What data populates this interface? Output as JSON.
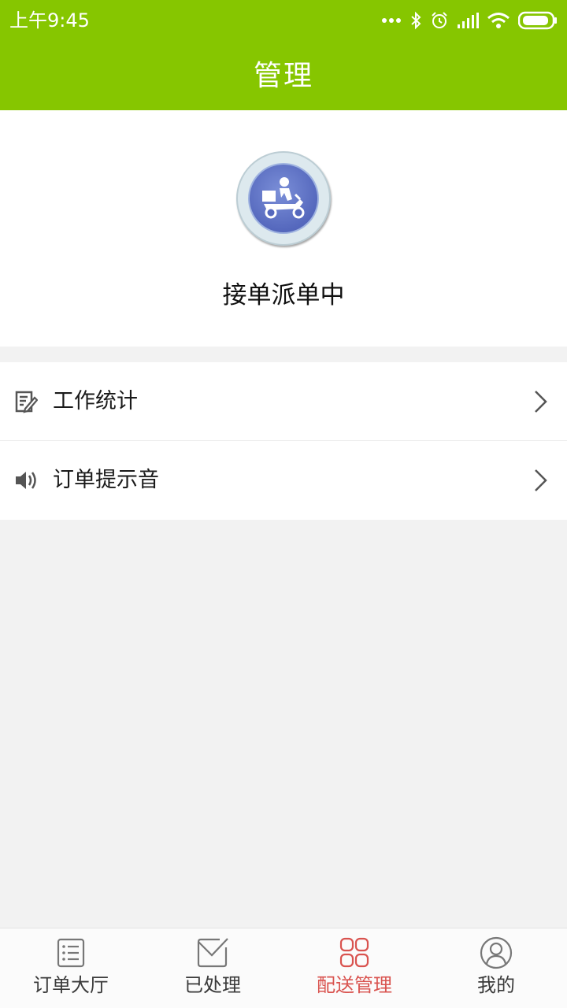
{
  "status_bar": {
    "time": "上午9:45",
    "icons": [
      "more-dots-icon",
      "bluetooth-icon",
      "alarm-icon",
      "signal-icon",
      "wifi-icon",
      "battery-icon"
    ]
  },
  "header": {
    "title": "管理"
  },
  "profile": {
    "avatar_icon": "delivery-scooter-icon",
    "status": "接单派单中"
  },
  "menu": {
    "items": [
      {
        "label": "工作统计",
        "icon": "edit-document-icon"
      },
      {
        "label": "订单提示音",
        "icon": "speaker-icon"
      }
    ]
  },
  "tabbar": {
    "items": [
      {
        "label": "订单大厅",
        "icon": "list-icon",
        "active": false
      },
      {
        "label": "已处理",
        "icon": "mail-check-icon",
        "active": false
      },
      {
        "label": "配送管理",
        "icon": "grid-icon",
        "active": true
      },
      {
        "label": "我的",
        "icon": "user-icon",
        "active": false
      }
    ]
  },
  "colors": {
    "header_bg": "#86c600",
    "page_bg": "#f2f2f2",
    "active_tab": "#d9534f",
    "avatar_blue": "#5568bd"
  }
}
